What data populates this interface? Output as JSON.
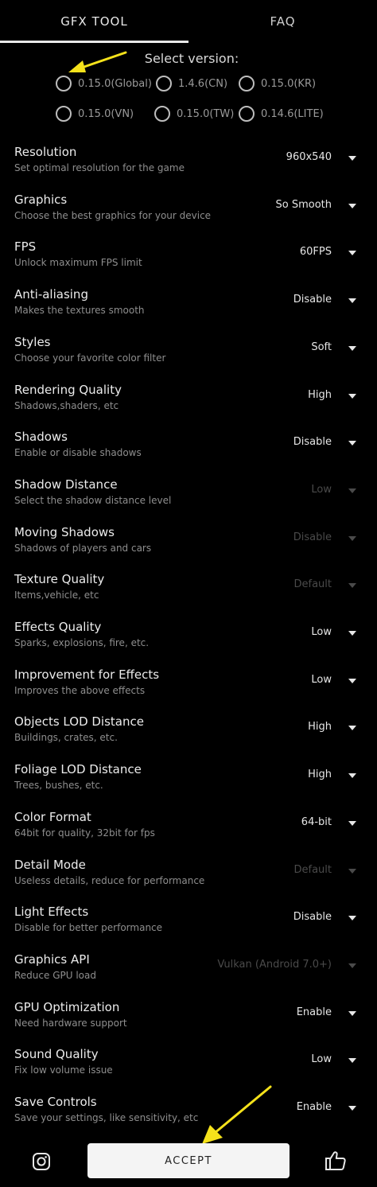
{
  "tabs": [
    {
      "label": "GFX TOOL",
      "active": true
    },
    {
      "label": "FAQ",
      "active": false
    }
  ],
  "version": {
    "title": "Select version:",
    "options": [
      "0.15.0(Global)",
      "1.4.6(CN)",
      "0.15.0(KR)",
      "0.15.0(VN)",
      "0.15.0(TW)",
      "0.14.6(LITE)"
    ]
  },
  "settings": [
    {
      "title": "Resolution",
      "subtitle": "Set optimal resolution for the game",
      "value": "960x540",
      "enabled": true
    },
    {
      "title": "Graphics",
      "subtitle": "Choose the best graphics for your device",
      "value": "So Smooth",
      "enabled": true
    },
    {
      "title": "FPS",
      "subtitle": "Unlock maximum FPS limit",
      "value": "60FPS",
      "enabled": true
    },
    {
      "title": "Anti-aliasing",
      "subtitle": "Makes the textures smooth",
      "value": "Disable",
      "enabled": true
    },
    {
      "title": "Styles",
      "subtitle": "Choose your favorite color filter",
      "value": "Soft",
      "enabled": true
    },
    {
      "title": "Rendering Quality",
      "subtitle": "Shadows,shaders, etc",
      "value": "High",
      "enabled": true
    },
    {
      "title": "Shadows",
      "subtitle": "Enable or disable shadows",
      "value": "Disable",
      "enabled": true
    },
    {
      "title": "Shadow Distance",
      "subtitle": "Select the shadow distance level",
      "value": "Low",
      "enabled": false
    },
    {
      "title": "Moving Shadows",
      "subtitle": "Shadows of players and cars",
      "value": "Disable",
      "enabled": false
    },
    {
      "title": "Texture Quality",
      "subtitle": "Items,vehicle, etc",
      "value": "Default",
      "enabled": false
    },
    {
      "title": "Effects Quality",
      "subtitle": "Sparks, explosions, fire, etc.",
      "value": "Low",
      "enabled": true
    },
    {
      "title": "Improvement for Effects",
      "subtitle": "Improves the above effects",
      "value": "Low",
      "enabled": true
    },
    {
      "title": "Objects LOD Distance",
      "subtitle": "Buildings, crates, etc.",
      "value": "High",
      "enabled": true
    },
    {
      "title": "Foliage LOD Distance",
      "subtitle": "Trees, bushes, etc.",
      "value": "High",
      "enabled": true
    },
    {
      "title": "Color Format",
      "subtitle": "64bit for quality, 32bit for fps",
      "value": "64-bit",
      "enabled": true
    },
    {
      "title": "Detail Mode",
      "subtitle": "Useless details, reduce for performance",
      "value": "Default",
      "enabled": false
    },
    {
      "title": "Light Effects",
      "subtitle": "Disable for better performance",
      "value": "Disable",
      "enabled": true
    },
    {
      "title": "Graphics API",
      "subtitle": "Reduce GPU load",
      "value": "Vulkan (Android 7.0+)",
      "enabled": false
    },
    {
      "title": "GPU Optimization",
      "subtitle": "Need hardware support",
      "value": "Enable",
      "enabled": true
    },
    {
      "title": "Sound Quality",
      "subtitle": "Fix low volume issue",
      "value": "Low",
      "enabled": true
    },
    {
      "title": "Save Controls",
      "subtitle": "Save your settings, like sensitivity, etc",
      "value": "Enable",
      "enabled": true
    }
  ],
  "bottom": {
    "accept_label": "ACCEPT",
    "left_icon": "instagram-icon",
    "right_icon": "thumbs-up-icon"
  },
  "colors": {
    "background": "#000000",
    "text": "#e6e6e6",
    "muted": "#8e8e8e",
    "disabled": "#4a4a4a",
    "annotation_arrow": "#f5e21b"
  }
}
